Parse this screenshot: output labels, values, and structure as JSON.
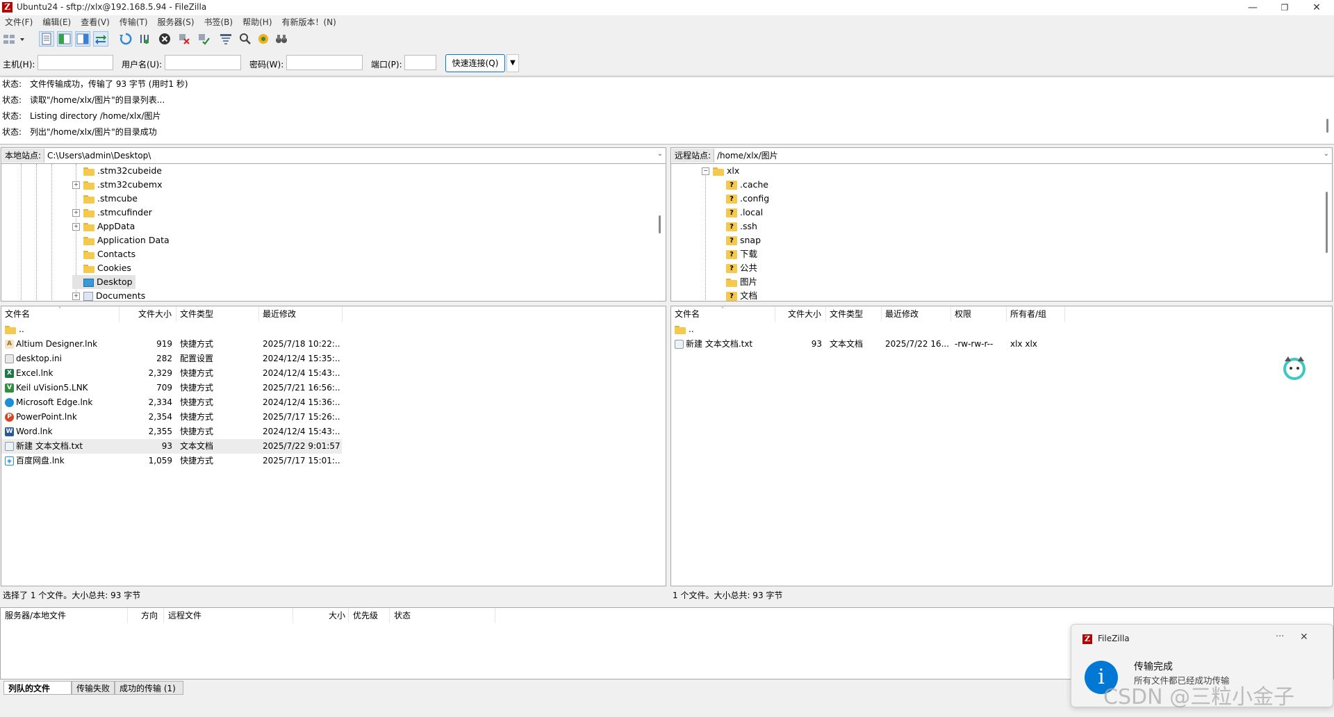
{
  "window": {
    "title": "Ubuntu24 - sftp://xlx@192.168.5.94 - FileZilla",
    "logo_letter": "Z",
    "minimize": "—",
    "maximize": "❐",
    "close": "✕"
  },
  "menu": [
    "文件(F)",
    "编辑(E)",
    "查看(V)",
    "传输(T)",
    "服务器(S)",
    "书签(B)",
    "帮助(H)",
    "有新版本！(N)"
  ],
  "quickconnect": {
    "host_label": "主机(H):",
    "user_label": "用户名(U):",
    "pass_label": "密码(W):",
    "port_label": "端口(P):",
    "host_value": "",
    "user_value": "",
    "pass_value": "",
    "port_value": "",
    "button": "快速连接(Q)",
    "dropdown": "▼"
  },
  "log": [
    {
      "key": "状态:",
      "text": "文件传输成功，传输了 93 字节 (用时1 秒)"
    },
    {
      "key": "状态:",
      "text": "读取\"/home/xlx/图片\"的目录列表..."
    },
    {
      "key": "状态:",
      "text": "Listing directory /home/xlx/图片"
    },
    {
      "key": "状态:",
      "text": "列出\"/home/xlx/图片\"的目录成功"
    }
  ],
  "local": {
    "site_label": "本地站点:",
    "path": "C:\\Users\\admin\\Desktop\\",
    "tree": [
      {
        "name": ".stm32cubeide",
        "expand": false
      },
      {
        "name": ".stm32cubemx",
        "expand": true
      },
      {
        "name": ".stmcube",
        "expand": false
      },
      {
        "name": ".stmcufinder",
        "expand": true
      },
      {
        "name": "AppData",
        "expand": true
      },
      {
        "name": "Application Data",
        "expand": false
      },
      {
        "name": "Contacts",
        "expand": false
      },
      {
        "name": "Cookies",
        "expand": false
      },
      {
        "name": "Desktop",
        "expand": false
      },
      {
        "name": "Documents",
        "expand": true
      }
    ],
    "columns": [
      "文件名",
      "文件大小",
      "文件类型",
      "最近修改"
    ],
    "files": [
      {
        "name": "..",
        "size": "",
        "type": "",
        "modified": ""
      },
      {
        "name": "Altium Designer.lnk",
        "size": "919",
        "type": "快捷方式",
        "modified": "2025/7/18 10:22:..."
      },
      {
        "name": "desktop.ini",
        "size": "282",
        "type": "配置设置",
        "modified": "2024/12/4 15:35:..."
      },
      {
        "name": "Excel.lnk",
        "size": "2,329",
        "type": "快捷方式",
        "modified": "2024/12/4 15:43:..."
      },
      {
        "name": "Keil uVision5.LNK",
        "size": "709",
        "type": "快捷方式",
        "modified": "2025/7/21 16:56:..."
      },
      {
        "name": "Microsoft Edge.lnk",
        "size": "2,334",
        "type": "快捷方式",
        "modified": "2024/12/4 15:36:..."
      },
      {
        "name": "PowerPoint.lnk",
        "size": "2,354",
        "type": "快捷方式",
        "modified": "2025/7/17 15:26:..."
      },
      {
        "name": "Word.lnk",
        "size": "2,355",
        "type": "快捷方式",
        "modified": "2024/12/4 15:43:..."
      },
      {
        "name": "新建 文本文档.txt",
        "size": "93",
        "type": "文本文档",
        "modified": "2025/7/22 9:01:57"
      },
      {
        "name": "百度网盘.lnk",
        "size": "1,059",
        "type": "快捷方式",
        "modified": "2025/7/17 15:01:..."
      }
    ],
    "status": "选择了 1 个文件。大小总共: 93 字节"
  },
  "remote": {
    "site_label": "远程站点:",
    "path": "/home/xlx/图片",
    "tree_root": "xlx",
    "tree": [
      {
        "name": ".cache",
        "q": true
      },
      {
        "name": ".config",
        "q": true
      },
      {
        "name": ".local",
        "q": true
      },
      {
        "name": ".ssh",
        "q": true
      },
      {
        "name": "snap",
        "q": true
      },
      {
        "name": "下载",
        "q": true
      },
      {
        "name": "公共",
        "q": true
      },
      {
        "name": "图片",
        "q": false
      },
      {
        "name": "文档",
        "q": true
      }
    ],
    "columns": [
      "文件名",
      "文件大小",
      "文件类型",
      "最近修改",
      "权限",
      "所有者/组"
    ],
    "files": [
      {
        "name": "..",
        "size": "",
        "type": "",
        "modified": "",
        "perm": "",
        "owner": ""
      },
      {
        "name": "新建 文本文档.txt",
        "size": "93",
        "type": "文本文档",
        "modified": "2025/7/22 16...",
        "perm": "-rw-rw-r--",
        "owner": "xlx xlx"
      }
    ],
    "status": "1 个文件。大小总共: 93 字节"
  },
  "queue": {
    "columns": [
      "服务器/本地文件",
      "方向",
      "远程文件",
      "大小",
      "优先级",
      "状态"
    ],
    "tabs": [
      "列队的文件",
      "传输失败",
      "成功的传输 (1)"
    ]
  },
  "toast": {
    "app": "FileZilla",
    "title": "传输完成",
    "message": "所有文件都已经成功传输",
    "more": "···",
    "close": "✕",
    "info": "i"
  },
  "watermark": "CSDN @三粒小金子",
  "colors": {
    "accent": "#0078d4",
    "logo": "#b50000",
    "folder": "#f4c94e"
  }
}
